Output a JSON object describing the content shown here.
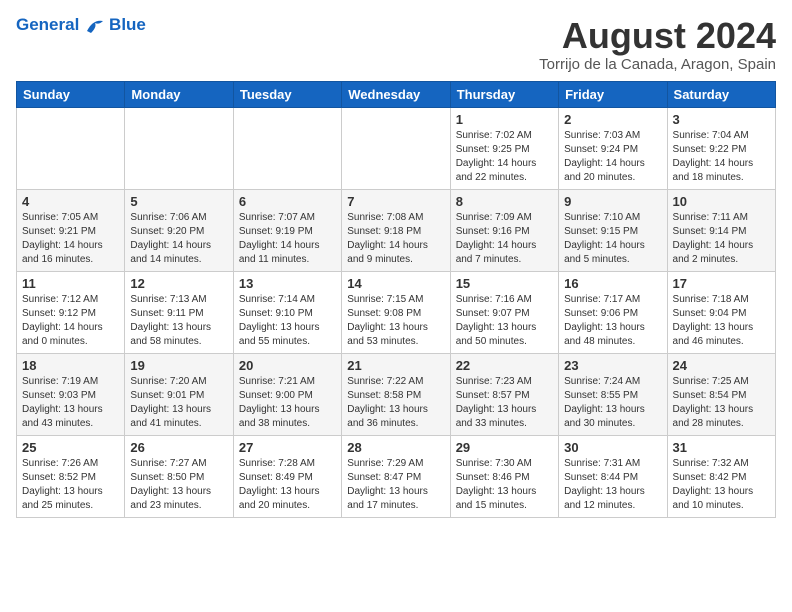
{
  "logo": {
    "line1": "General",
    "line2": "Blue"
  },
  "title": {
    "month_year": "August 2024",
    "location": "Torrijo de la Canada, Aragon, Spain"
  },
  "weekdays": [
    "Sunday",
    "Monday",
    "Tuesday",
    "Wednesday",
    "Thursday",
    "Friday",
    "Saturday"
  ],
  "weeks": [
    [
      {
        "day": "",
        "info": ""
      },
      {
        "day": "",
        "info": ""
      },
      {
        "day": "",
        "info": ""
      },
      {
        "day": "",
        "info": ""
      },
      {
        "day": "1",
        "info": "Sunrise: 7:02 AM\nSunset: 9:25 PM\nDaylight: 14 hours\nand 22 minutes."
      },
      {
        "day": "2",
        "info": "Sunrise: 7:03 AM\nSunset: 9:24 PM\nDaylight: 14 hours\nand 20 minutes."
      },
      {
        "day": "3",
        "info": "Sunrise: 7:04 AM\nSunset: 9:22 PM\nDaylight: 14 hours\nand 18 minutes."
      }
    ],
    [
      {
        "day": "4",
        "info": "Sunrise: 7:05 AM\nSunset: 9:21 PM\nDaylight: 14 hours\nand 16 minutes."
      },
      {
        "day": "5",
        "info": "Sunrise: 7:06 AM\nSunset: 9:20 PM\nDaylight: 14 hours\nand 14 minutes."
      },
      {
        "day": "6",
        "info": "Sunrise: 7:07 AM\nSunset: 9:19 PM\nDaylight: 14 hours\nand 11 minutes."
      },
      {
        "day": "7",
        "info": "Sunrise: 7:08 AM\nSunset: 9:18 PM\nDaylight: 14 hours\nand 9 minutes."
      },
      {
        "day": "8",
        "info": "Sunrise: 7:09 AM\nSunset: 9:16 PM\nDaylight: 14 hours\nand 7 minutes."
      },
      {
        "day": "9",
        "info": "Sunrise: 7:10 AM\nSunset: 9:15 PM\nDaylight: 14 hours\nand 5 minutes."
      },
      {
        "day": "10",
        "info": "Sunrise: 7:11 AM\nSunset: 9:14 PM\nDaylight: 14 hours\nand 2 minutes."
      }
    ],
    [
      {
        "day": "11",
        "info": "Sunrise: 7:12 AM\nSunset: 9:12 PM\nDaylight: 14 hours\nand 0 minutes."
      },
      {
        "day": "12",
        "info": "Sunrise: 7:13 AM\nSunset: 9:11 PM\nDaylight: 13 hours\nand 58 minutes."
      },
      {
        "day": "13",
        "info": "Sunrise: 7:14 AM\nSunset: 9:10 PM\nDaylight: 13 hours\nand 55 minutes."
      },
      {
        "day": "14",
        "info": "Sunrise: 7:15 AM\nSunset: 9:08 PM\nDaylight: 13 hours\nand 53 minutes."
      },
      {
        "day": "15",
        "info": "Sunrise: 7:16 AM\nSunset: 9:07 PM\nDaylight: 13 hours\nand 50 minutes."
      },
      {
        "day": "16",
        "info": "Sunrise: 7:17 AM\nSunset: 9:06 PM\nDaylight: 13 hours\nand 48 minutes."
      },
      {
        "day": "17",
        "info": "Sunrise: 7:18 AM\nSunset: 9:04 PM\nDaylight: 13 hours\nand 46 minutes."
      }
    ],
    [
      {
        "day": "18",
        "info": "Sunrise: 7:19 AM\nSunset: 9:03 PM\nDaylight: 13 hours\nand 43 minutes."
      },
      {
        "day": "19",
        "info": "Sunrise: 7:20 AM\nSunset: 9:01 PM\nDaylight: 13 hours\nand 41 minutes."
      },
      {
        "day": "20",
        "info": "Sunrise: 7:21 AM\nSunset: 9:00 PM\nDaylight: 13 hours\nand 38 minutes."
      },
      {
        "day": "21",
        "info": "Sunrise: 7:22 AM\nSunset: 8:58 PM\nDaylight: 13 hours\nand 36 minutes."
      },
      {
        "day": "22",
        "info": "Sunrise: 7:23 AM\nSunset: 8:57 PM\nDaylight: 13 hours\nand 33 minutes."
      },
      {
        "day": "23",
        "info": "Sunrise: 7:24 AM\nSunset: 8:55 PM\nDaylight: 13 hours\nand 30 minutes."
      },
      {
        "day": "24",
        "info": "Sunrise: 7:25 AM\nSunset: 8:54 PM\nDaylight: 13 hours\nand 28 minutes."
      }
    ],
    [
      {
        "day": "25",
        "info": "Sunrise: 7:26 AM\nSunset: 8:52 PM\nDaylight: 13 hours\nand 25 minutes."
      },
      {
        "day": "26",
        "info": "Sunrise: 7:27 AM\nSunset: 8:50 PM\nDaylight: 13 hours\nand 23 minutes."
      },
      {
        "day": "27",
        "info": "Sunrise: 7:28 AM\nSunset: 8:49 PM\nDaylight: 13 hours\nand 20 minutes."
      },
      {
        "day": "28",
        "info": "Sunrise: 7:29 AM\nSunset: 8:47 PM\nDaylight: 13 hours\nand 17 minutes."
      },
      {
        "day": "29",
        "info": "Sunrise: 7:30 AM\nSunset: 8:46 PM\nDaylight: 13 hours\nand 15 minutes."
      },
      {
        "day": "30",
        "info": "Sunrise: 7:31 AM\nSunset: 8:44 PM\nDaylight: 13 hours\nand 12 minutes."
      },
      {
        "day": "31",
        "info": "Sunrise: 7:32 AM\nSunset: 8:42 PM\nDaylight: 13 hours\nand 10 minutes."
      }
    ]
  ]
}
